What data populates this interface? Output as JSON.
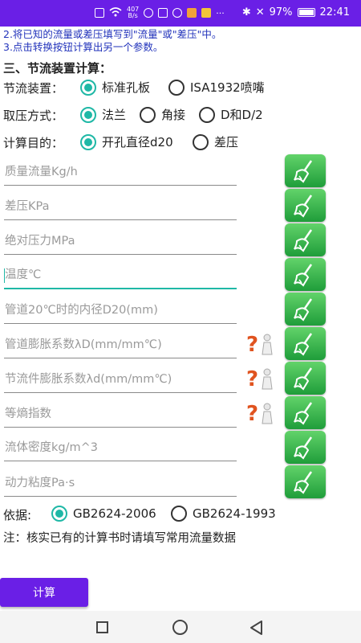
{
  "status_bar": {
    "net_speed_value": "407",
    "net_speed_unit": "B/s",
    "battery": "97%",
    "time": "22:41"
  },
  "hints": [
    "2.将已知的流量或差压填写到\"流量\"或\"差压\"中。",
    "3.点击转换按钮计算出另一个参数。"
  ],
  "section_title": "三、节流装置计算：",
  "device": {
    "label": "节流装置：",
    "options": [
      "标准孔板",
      "ISA1932喷嘴"
    ],
    "selected": "标准孔板"
  },
  "tapping": {
    "label": "取压方式：",
    "options": [
      "法兰",
      "角接",
      "D和D/2"
    ],
    "selected": "法兰"
  },
  "purpose": {
    "label": "计算目的：",
    "options": [
      "开孔直径d20",
      "差压"
    ],
    "selected": "开孔直径d20"
  },
  "fields": [
    {
      "placeholder": "质量流量Kg/h",
      "value": ""
    },
    {
      "placeholder": "差压KPa",
      "value": ""
    },
    {
      "placeholder": "绝对压力MPa",
      "value": ""
    },
    {
      "placeholder": "温度℃",
      "value": ""
    },
    {
      "placeholder": "管道20℃时的内径D20(mm)",
      "value": ""
    },
    {
      "placeholder": "管道膨胀系数λD(mm/mm℃)",
      "value": ""
    },
    {
      "placeholder": "节流件膨胀系数λd(mm/mm℃)",
      "value": ""
    },
    {
      "placeholder": "等熵指数",
      "value": ""
    },
    {
      "placeholder": "流体密度kg/m^3",
      "value": ""
    },
    {
      "placeholder": "动力粘度Pa·s",
      "value": ""
    }
  ],
  "basis": {
    "label": "依据:",
    "options": [
      "GB2624-2006",
      "GB2624-1993"
    ],
    "selected": "GB2624-2006"
  },
  "note": "注：核实已有的计算书时请填写常用流量数据",
  "calc_button": "计算",
  "colors": {
    "accent": "#6a1fe6",
    "radio_checked": "#1fb8a6",
    "clear_button": "#3cb44b",
    "hint_text": "#2233bb"
  },
  "icons": {
    "clear": "broom-icon",
    "help": "question-mark-figure-icon"
  }
}
